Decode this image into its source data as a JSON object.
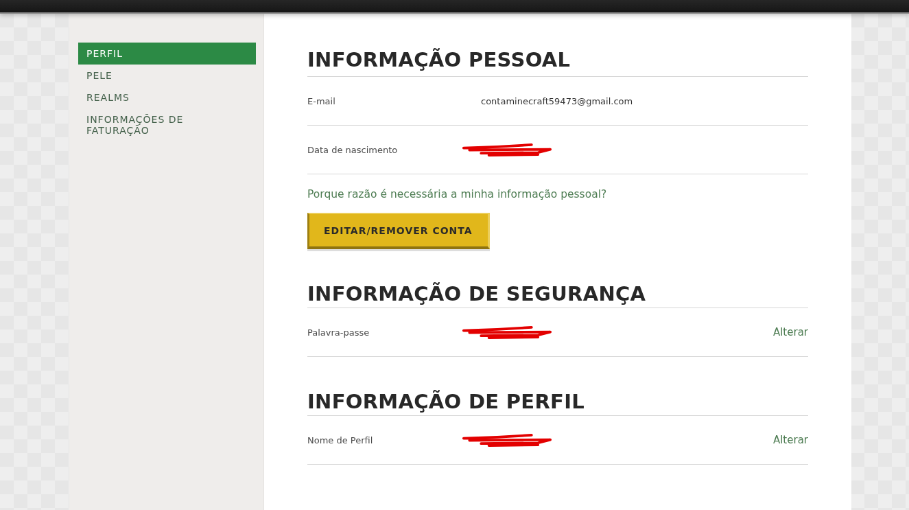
{
  "sidebar": {
    "items": [
      {
        "label": "PERFIL",
        "selected": true
      },
      {
        "label": "PELE",
        "selected": false
      },
      {
        "label": "REALMS",
        "selected": false
      },
      {
        "label": "INFORMAÇÕES DE FATURAÇÃO",
        "selected": false
      }
    ]
  },
  "sections": [
    {
      "title": "INFORMAÇÃO PESSOAL",
      "rows": [
        {
          "label": "E-mail",
          "value": "contaminecraft59473@gmail.com",
          "redacted": false
        },
        {
          "label": "Data de nascimento",
          "redacted": true
        }
      ],
      "link": "Porque razão é necessária a minha informação pessoal?",
      "button": "EDITAR/REMOVER CONTA"
    },
    {
      "title": "INFORMAÇÃO DE SEGURANÇA",
      "rows": [
        {
          "label": "Palavra-passe",
          "redacted": true,
          "action": "Alterar"
        }
      ]
    },
    {
      "title": "INFORMAÇÃO DE PERFIL",
      "rows": [
        {
          "label": "Nome de Perfil",
          "redacted": true,
          "action": "Alterar"
        }
      ]
    }
  ]
}
